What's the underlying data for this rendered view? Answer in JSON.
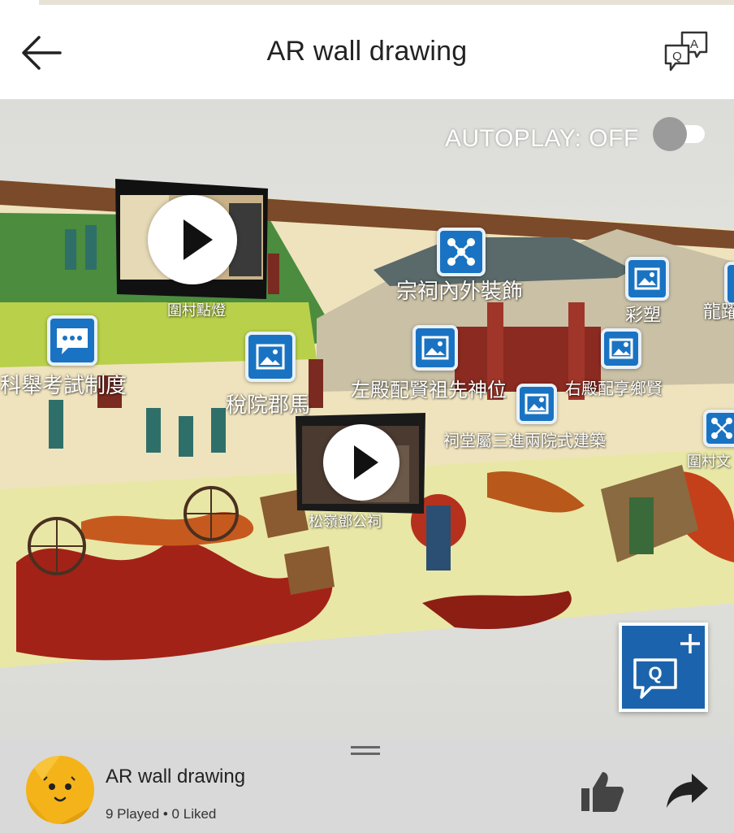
{
  "header": {
    "title": "AR wall drawing",
    "back_icon": "arrow-left-icon",
    "qa_icon": "question-answer-icon"
  },
  "ar_view": {
    "autoplay_label": "AUTOPLAY: OFF",
    "autoplay_on": false,
    "videos": [
      {
        "label": "圍村點燈"
      },
      {
        "label": "松嶺鄧公祠"
      }
    ],
    "hotspots": [
      {
        "icon": "network-icon",
        "label": "宗祠內外裝飾"
      },
      {
        "icon": "image-icon",
        "label": "彩塑"
      },
      {
        "icon": "image-icon",
        "label": "龍躍"
      },
      {
        "icon": "chat-icon",
        "label": "科舉考試制度"
      },
      {
        "icon": "image-icon",
        "label": "稅院郡馬"
      },
      {
        "icon": "image-icon",
        "label": "左殿配賢祖先神位"
      },
      {
        "icon": "image-icon",
        "label": "右殿配享鄉賢"
      },
      {
        "icon": "image-icon",
        "label": "祠堂屬三進兩院式建築"
      },
      {
        "icon": "network-icon",
        "label": "圍村文"
      }
    ],
    "add_question_icon": "add-question-icon",
    "colors": {
      "accent": "#1a73c2",
      "button": "#1b64ad"
    }
  },
  "bottom": {
    "title": "AR wall drawing",
    "stats": "9 Played • 0 Liked",
    "like_icon": "thumbs-up-icon",
    "share_icon": "share-arrow-icon"
  }
}
